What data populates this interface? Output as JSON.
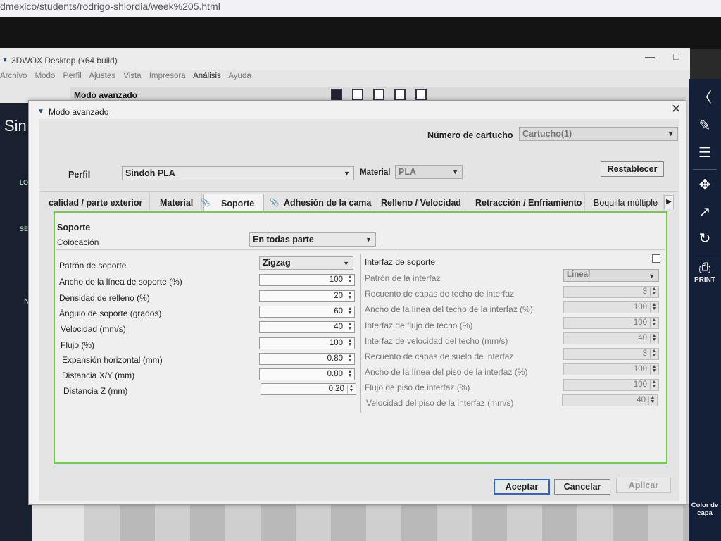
{
  "browser": {
    "url_text": "dmexico/students/rodrigo-shiordia/week%205.html"
  },
  "app": {
    "window_title": "3DWOX Desktop (x64 build)",
    "menu": [
      "Archivo",
      "Modo",
      "Perfil",
      "Ajustes",
      "Vista",
      "Impresora",
      "Análisis",
      "Ayuda"
    ],
    "mode_label": "Modo avanzado",
    "left_title": "Sin",
    "left_labels": [
      "LO",
      "SET",
      "No"
    ],
    "right_print_label": "PRINT",
    "right_color_label": "Color de capa"
  },
  "dialog": {
    "title": "Modo avanzado",
    "cartridge_label": "Número de cartucho",
    "cartridge_value": "Cartucho(1)",
    "profile_label": "Perfil",
    "profile_value": "Sindoh PLA",
    "material_label": "Material",
    "material_value": "PLA",
    "reset_label": "Restablecer",
    "tabs": [
      "calidad / parte exterior",
      "Material",
      "Soporte",
      "Adhesión de la cama",
      "Relleno / Velocidad",
      "Retracción / Enfriamiento",
      "Boquilla múltiple"
    ],
    "active_tab": "Soporte",
    "section_title": "Soporte",
    "placement_label": "Colocación",
    "placement_value": "En todas parte",
    "left_rows": [
      {
        "label": "Patrón de soporte",
        "value": "Zigzag"
      },
      {
        "label": "Ancho de la línea de soporte (%)",
        "value": "100"
      },
      {
        "label": "Densidad de relleno (%)",
        "value": "20"
      },
      {
        "label": "Ángulo de soporte (grados)",
        "value": "60"
      },
      {
        "label": "Velocidad (mm/s)",
        "value": "40"
      },
      {
        "label": "Flujo (%)",
        "value": "100"
      },
      {
        "label": "Expansión horizontal (mm)",
        "value": "0.80"
      },
      {
        "label": "Distancia X/Y (mm)",
        "value": "0.80"
      },
      {
        "label": "Distancia Z (mm)",
        "value": "0.20"
      }
    ],
    "interface_label": "Interfaz de soporte",
    "interface_checked": false,
    "right_rows": [
      {
        "label": "Patrón de la interfaz",
        "value": "Lineal"
      },
      {
        "label": "Recuento de capas de techo de interfaz",
        "value": "3"
      },
      {
        "label": "Ancho de la línea del techo de la interfaz (%)",
        "value": "100"
      },
      {
        "label": "Interfaz de flujo de techo (%)",
        "value": "100"
      },
      {
        "label": "Interfaz de velocidad del techo (mm/s)",
        "value": "40"
      },
      {
        "label": "Recuento de capas de suelo de interfaz",
        "value": "3"
      },
      {
        "label": "Ancho de la línea del piso de la interfaz (%)",
        "value": "100"
      },
      {
        "label": "Flujo de piso de interfaz (%)",
        "value": "100"
      },
      {
        "label": "Velocidad del piso de la interfaz (mm/s)",
        "value": "40"
      }
    ],
    "buttons": {
      "accept": "Aceptar",
      "cancel": "Cancelar",
      "apply": "Aplicar"
    }
  },
  "colors": {
    "accent_border": "#6fd03e",
    "primary_button_border": "#2f63c4",
    "sidebar_bg": "#142038"
  }
}
